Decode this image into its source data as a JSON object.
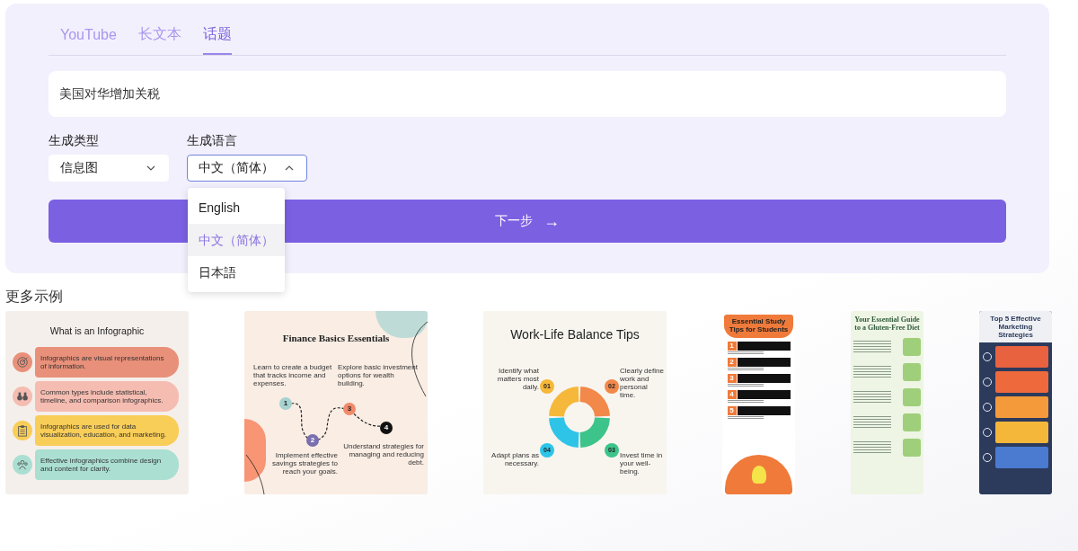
{
  "tabs": [
    {
      "label": "YouTube",
      "selected": false
    },
    {
      "label": "长文本",
      "selected": false
    },
    {
      "label": "话题",
      "selected": true
    }
  ],
  "topic_input": {
    "value": "美国对华增加关税"
  },
  "type_select": {
    "label": "生成类型",
    "value": "信息图",
    "expanded": false
  },
  "language_select": {
    "label": "生成语言",
    "value": "中文（简体）",
    "expanded": true,
    "options": [
      {
        "label": "English",
        "selected": false
      },
      {
        "label": "中文（简体）",
        "selected": true
      },
      {
        "label": "日本語",
        "selected": false
      }
    ]
  },
  "next_button": {
    "label": "下一步",
    "arrow": "→"
  },
  "examples": {
    "title": "更多示例",
    "items": [
      {
        "kind": "list",
        "title": "What is an Infographic",
        "points": [
          {
            "text": "Infographics are visual representations of information.",
            "color": "#e8907a"
          },
          {
            "text": "Common types include statistical, timeline, and comparison infographics.",
            "color": "#f5bcb1"
          },
          {
            "text": "Infographics are used for data visualization, education, and marketing.",
            "color": "#f8cd58"
          },
          {
            "text": "Effective infographics combine design and content for clarity.",
            "color": "#aadfd2"
          }
        ]
      },
      {
        "kind": "path",
        "title": "Finance Basics Essentials",
        "steps": [
          {
            "number": "1",
            "text": "Learn to create a budget that tracks income and expenses."
          },
          {
            "number": "2",
            "text": "Implement effective savings strategies to reach your goals."
          },
          {
            "number": "3",
            "text": "Explore basic investment options for wealth building."
          },
          {
            "number": "4",
            "text": "Understand strategies for managing and reducing debt."
          }
        ]
      },
      {
        "kind": "cycle",
        "title": "Work-Life Balance Tips",
        "tips": [
          {
            "number": "01",
            "text": "Identify what matters most daily."
          },
          {
            "number": "02",
            "text": "Clearly define work and personal time."
          },
          {
            "number": "04",
            "text": "Adapt plans as necessary."
          },
          {
            "number": "03",
            "text": "Invest time in your well-being."
          }
        ]
      },
      {
        "kind": "study",
        "title": "Essential Study Tips for Students",
        "numbers": [
          "1",
          "2",
          "3",
          "4",
          "5"
        ]
      },
      {
        "kind": "guide",
        "title": "Your Essential Guide to a Gluten-Free Diet"
      },
      {
        "kind": "strategies",
        "title": "Top 5 Effective Marketing Strategies"
      }
    ]
  }
}
